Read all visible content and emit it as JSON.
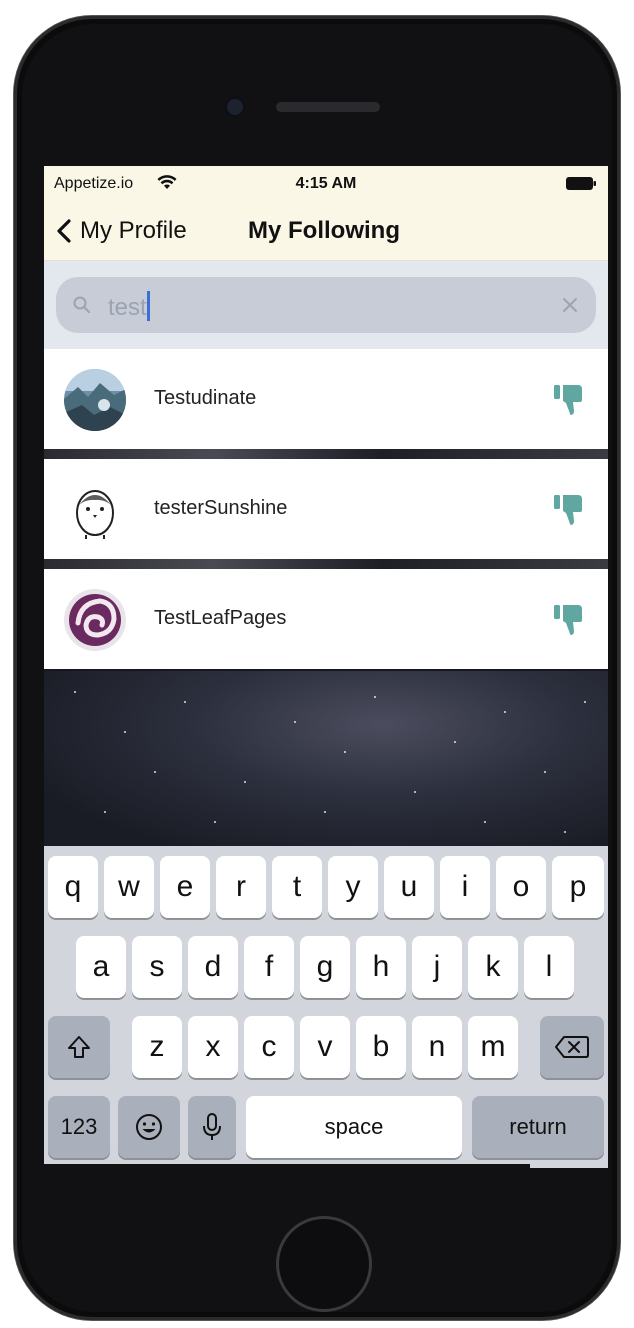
{
  "status_bar": {
    "carrier": "Appetize.io",
    "time": "4:15 AM"
  },
  "nav": {
    "back_label": "My Profile",
    "title": "My Following"
  },
  "search": {
    "value": "test"
  },
  "following": [
    {
      "name": "Testudinate"
    },
    {
      "name": "testerSunshine"
    },
    {
      "name": "TestLeafPages"
    }
  ],
  "keyboard": {
    "row1": [
      "q",
      "w",
      "e",
      "r",
      "t",
      "y",
      "u",
      "i",
      "o",
      "p"
    ],
    "row2": [
      "a",
      "s",
      "d",
      "f",
      "g",
      "h",
      "j",
      "k",
      "l"
    ],
    "row3": [
      "z",
      "x",
      "c",
      "v",
      "b",
      "n",
      "m"
    ],
    "numbers_label": "123",
    "space_label": "space",
    "return_label": "return"
  },
  "colors": {
    "nav_background": "#fbf7e6",
    "unfollow_icon": "#5fa7a0",
    "caret": "#3d6ed8"
  }
}
